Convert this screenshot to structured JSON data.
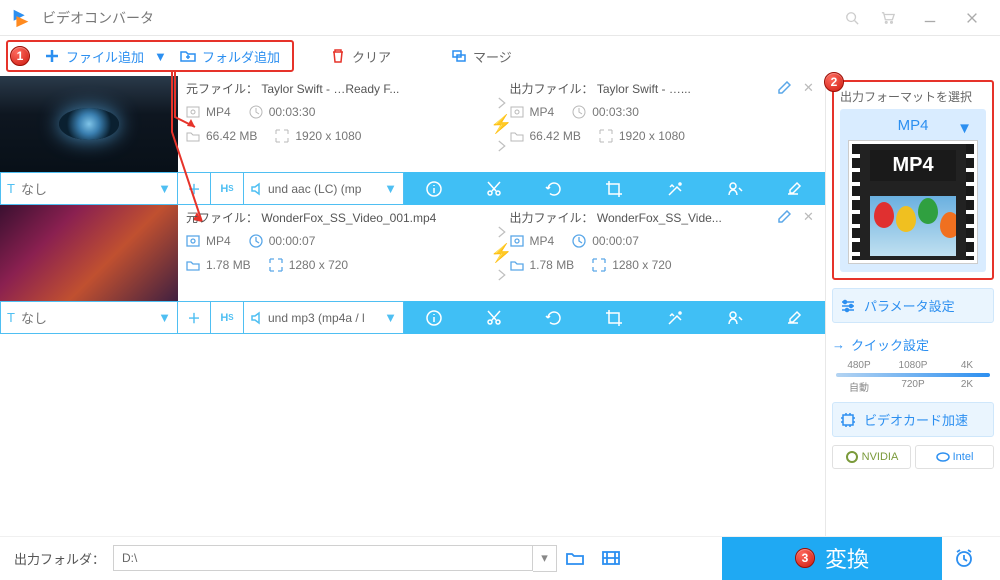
{
  "titlebar": {
    "title": "ビデオコンバータ"
  },
  "toolbar": {
    "add_file": "ファイル追加",
    "add_folder": "フォルダ追加",
    "clear": "クリア",
    "merge": "マージ"
  },
  "files": [
    {
      "subtitle": "なし",
      "audio": "und aac (LC) (mp",
      "src": {
        "header": "元ファイル： Taylor Swift - …Ready F...",
        "format": "MP4",
        "duration": "00:03:30",
        "size": "66.42 MB",
        "res": "1920 x 1080"
      },
      "out": {
        "header": "出力ファイル： Taylor Swift - …...",
        "format": "MP4",
        "duration": "00:03:30",
        "size": "66.42 MB",
        "res": "1920 x 1080"
      }
    },
    {
      "subtitle": "なし",
      "audio": "und mp3 (mp4a / l",
      "src": {
        "header": "元ファイル： WonderFox_SS_Video_001.mp4",
        "format": "MP4",
        "duration": "00:00:07",
        "size": "1.78 MB",
        "res": "1280 x 720"
      },
      "out": {
        "header": "出力ファイル： WonderFox_SS_Vide...",
        "format": "MP4",
        "duration": "00:00:07",
        "size": "1.78 MB",
        "res": "1280 x 720"
      }
    }
  ],
  "sidebar": {
    "select_format": "出力フォーマットを選択",
    "format": "MP4",
    "format_badge": "MP4",
    "param_settings": "パラメータ設定",
    "quick_settings": "クイック設定",
    "presets_top": [
      "480P",
      "1080P",
      "4K"
    ],
    "presets_bottom": [
      "自動",
      "720P",
      "2K"
    ],
    "gpu_accel": "ビデオカード加速",
    "nvidia": "NVIDIA",
    "intel": "Intel"
  },
  "bottom": {
    "label": "出力フォルダ：",
    "path": "D:\\",
    "convert": "変換"
  },
  "badges": {
    "b1": "1",
    "b2": "2",
    "b3": "3"
  }
}
